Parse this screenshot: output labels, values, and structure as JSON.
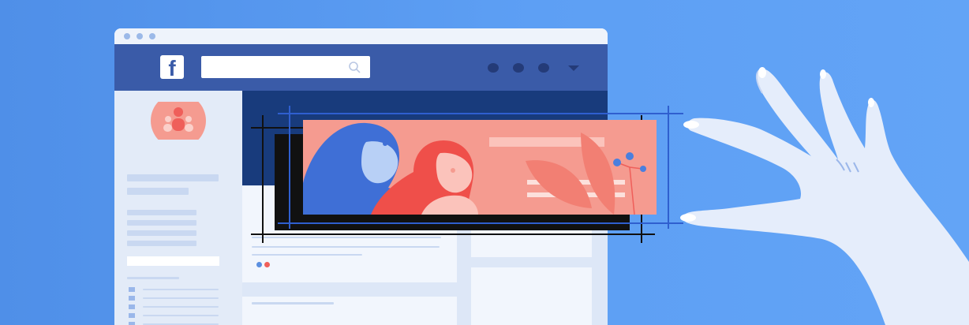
{
  "app": {
    "logo_letter": "f",
    "brand_colors": {
      "background": "#5b9cf2",
      "header": "#3a5ba8",
      "cover": "#183b7c",
      "accent_pink": "#f59b90",
      "accent_red": "#ef5f5a"
    }
  },
  "header": {
    "search": {
      "placeholder": "",
      "icon": "search-icon"
    },
    "menu_icons": [
      "dot-icon",
      "dot-icon",
      "dot-icon",
      "chevron-down-icon"
    ]
  },
  "cover_art": {
    "icons": [
      "woman-blue-illustration",
      "woman-red-illustration",
      "leaf-icon",
      "flower-icon"
    ]
  }
}
